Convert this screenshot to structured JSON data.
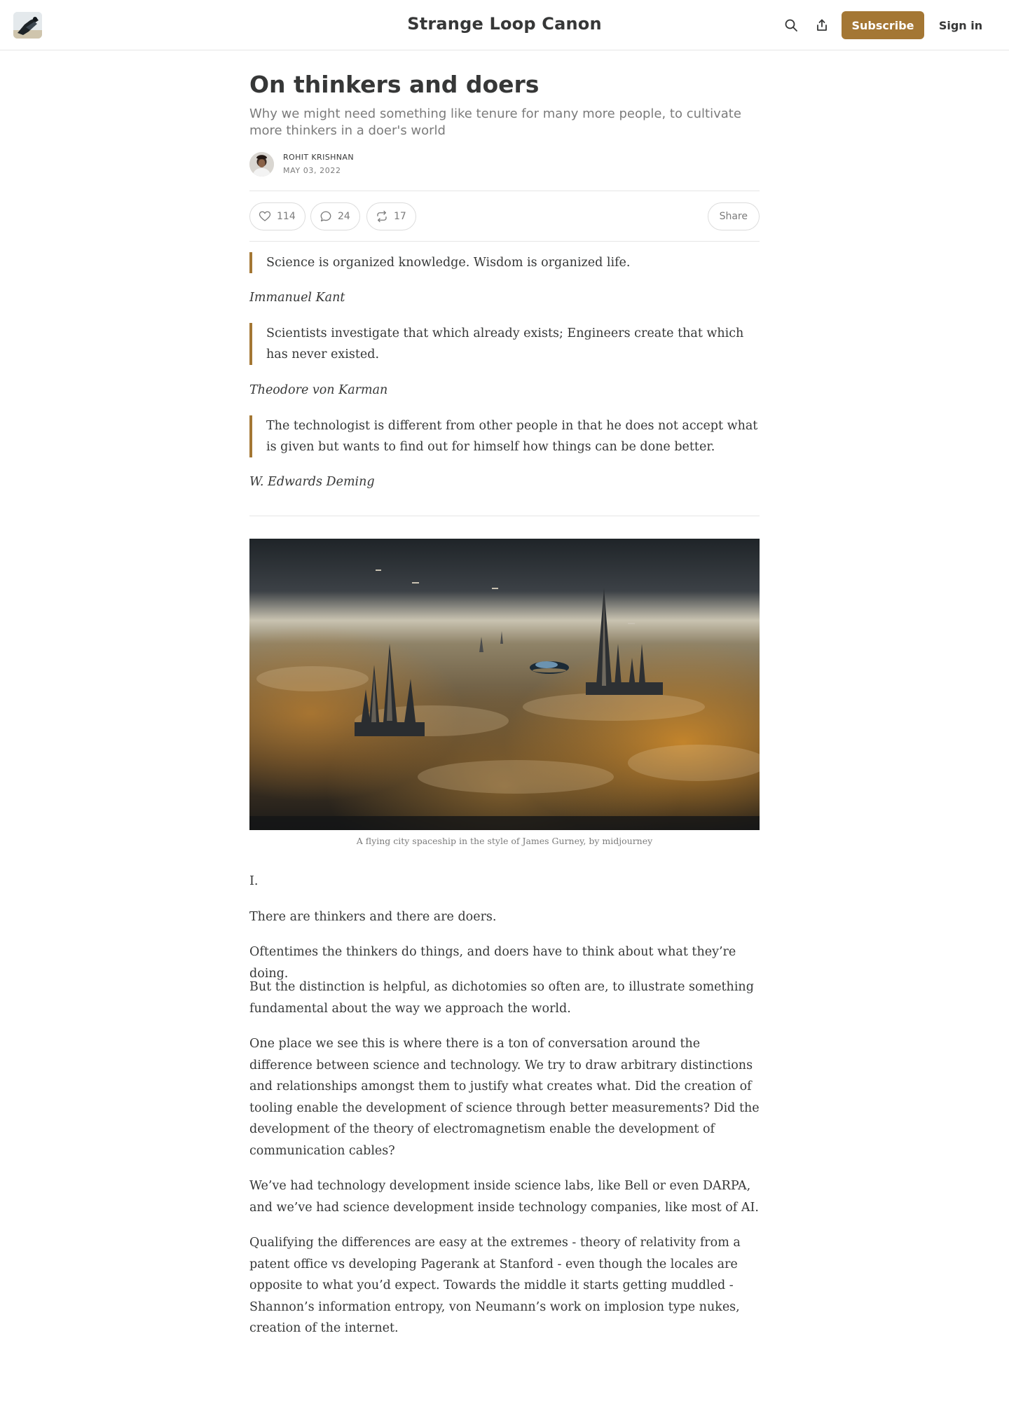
{
  "header": {
    "publication_title": "Strange Loop Canon",
    "subscribe_label": "Subscribe",
    "signin_label": "Sign in",
    "icons": [
      "search-icon",
      "share-upload-icon"
    ]
  },
  "post": {
    "title": "On thinkers and doers",
    "subtitle": "Why we might need something like tenure for many more people, to cultivate more thinkers in a doer's world",
    "author": "ROHIT KRISHNAN",
    "date": "MAY 03, 2022",
    "likes": "114",
    "comments": "24",
    "restacks": "17",
    "share_label": "Share"
  },
  "epigraphs": [
    {
      "quote": "Science is organized knowledge. Wisdom is organized life.",
      "author": "Immanuel Kant"
    },
    {
      "quote": "Scientists investigate that which already exists; Engineers create that which has never existed.",
      "author": "Theodore von Karman"
    },
    {
      "quote": "The technologist is different from other people in that he does not accept what is given but wants to find out for himself how things can be done better.",
      "author": "W. Edwards Deming"
    }
  ],
  "image": {
    "caption": "A flying city spaceship in the style of James Gurney, by midjourney"
  },
  "section_heading": "I.",
  "paragraphs": [
    "There are thinkers and there are doers.",
    "Oftentimes the thinkers do things, and doers have to think about what they’re doing.",
    "But the distinction is helpful, as dichotomies so often are, to illustrate something fundamental about the way we approach the world.",
    "One place we see this is where there is a ton of conversation around the difference between science and technology. We try to draw arbitrary distinctions and relationships amongst them to justify what creates what. Did the creation of tooling enable the development of science through better measurements? Did the development of the theory of electromagnetism enable the development of communication cables?",
    "We’ve had technology development inside science labs, like Bell or even DARPA, and we’ve had science development inside technology companies, like most of AI.",
    "Qualifying the differences are easy at the extremes - theory of relativity from a patent office vs developing Pagerank at Stanford - even though the locales are opposite to what you’d expect. Towards the middle it starts getting muddled - Shannon’s information entropy, von Neumann’s work on implosion type nukes, creation of the internet."
  ],
  "colors": {
    "accent": "#a47734",
    "text": "#363737",
    "muted": "#7b7b7b",
    "border": "#e6e6e6"
  }
}
